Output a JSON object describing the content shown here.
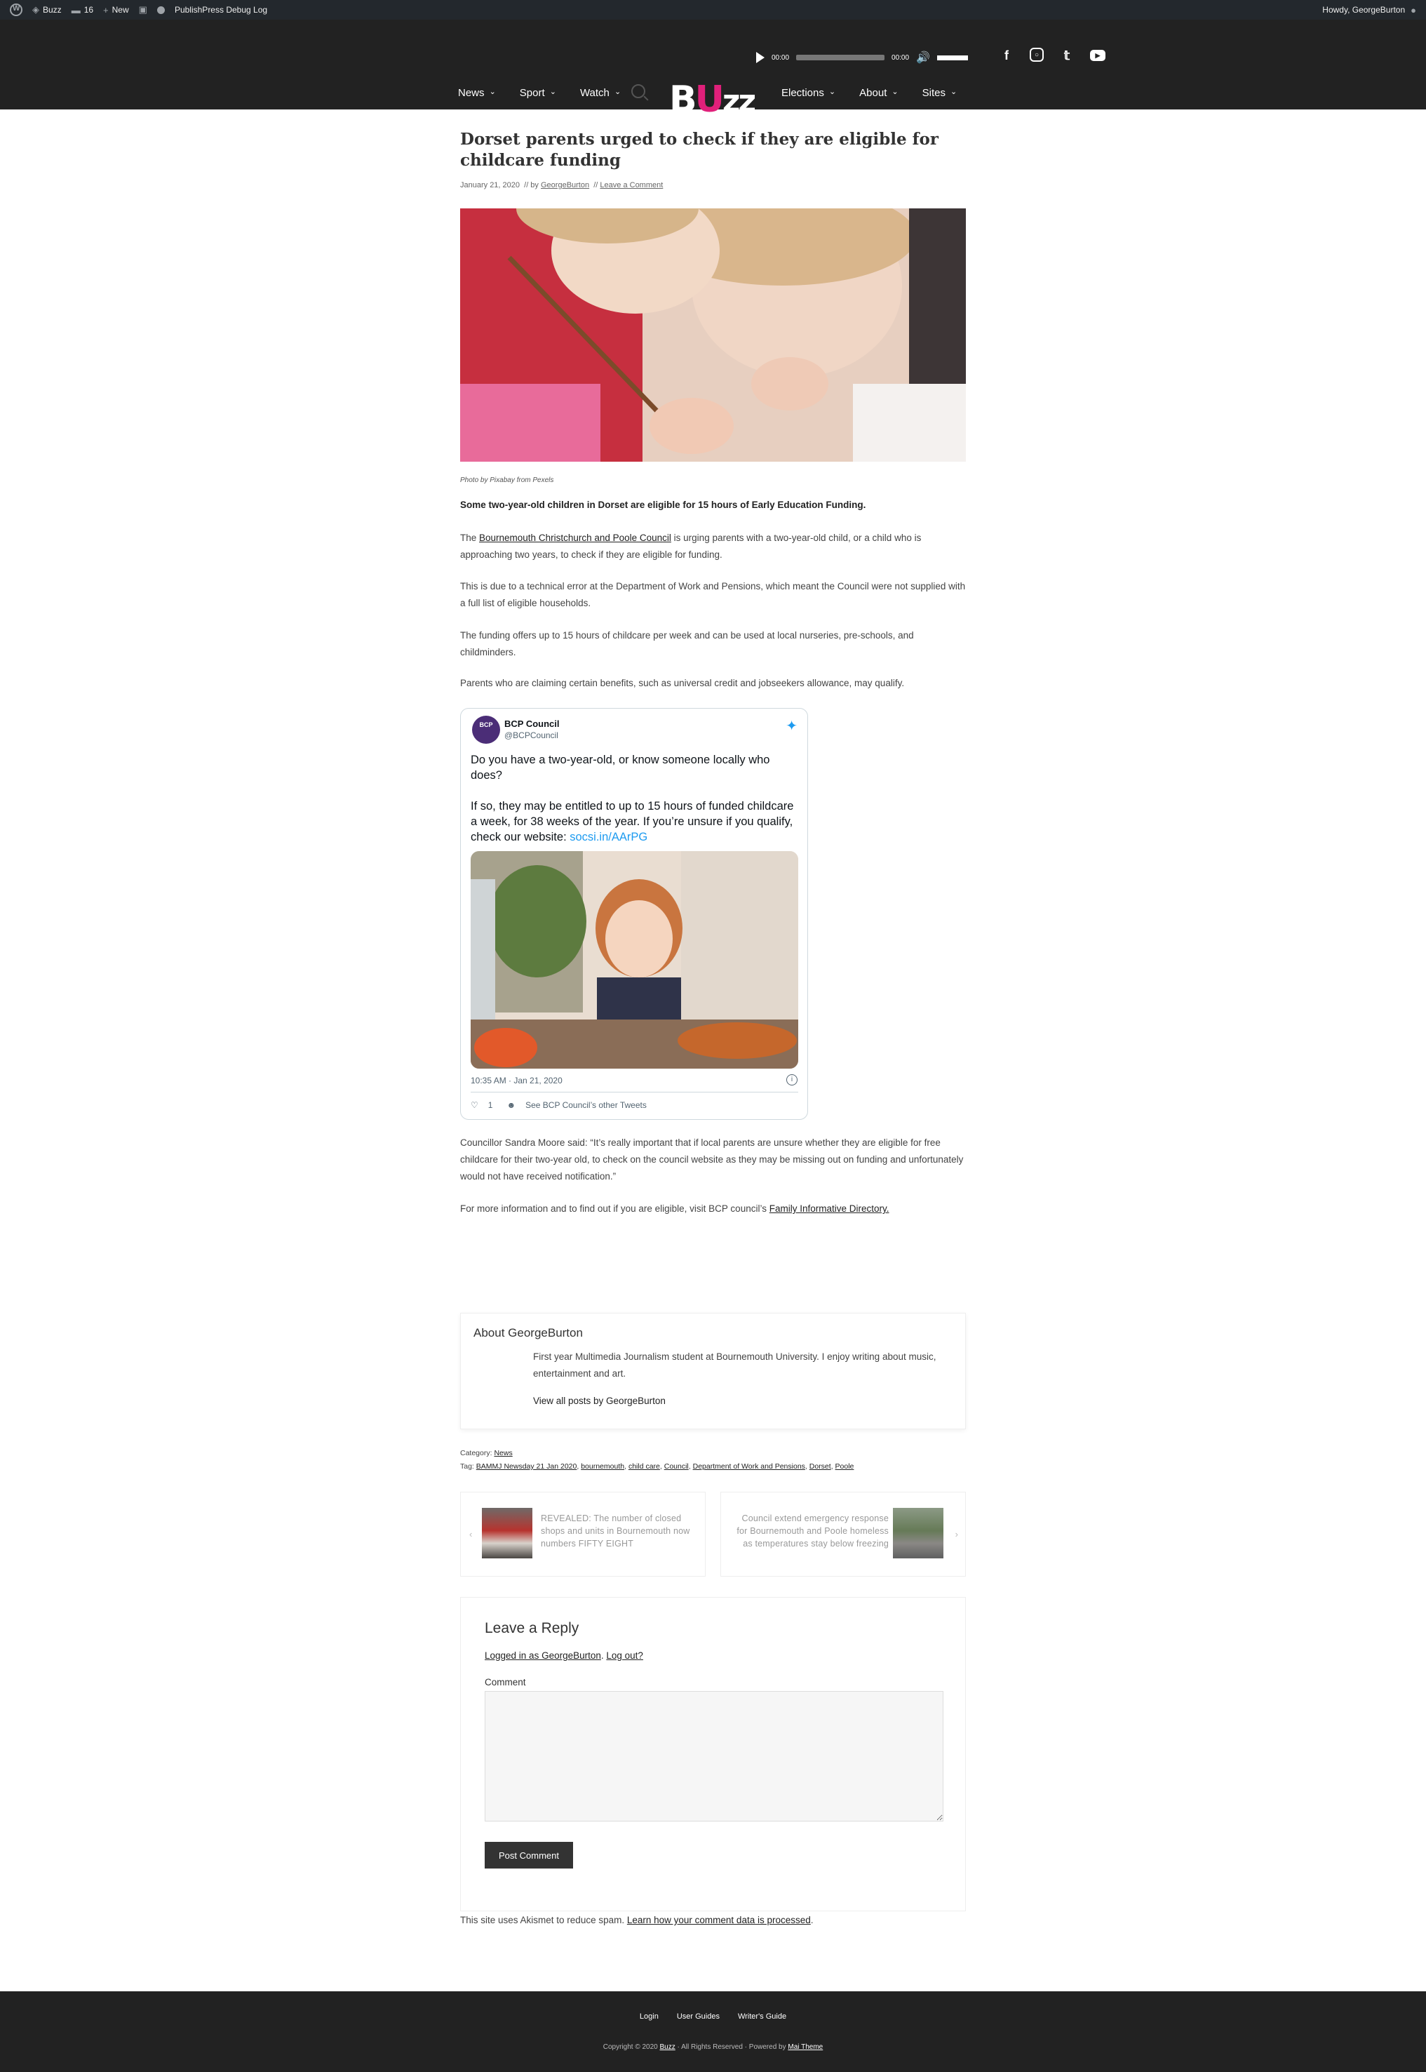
{
  "adminbar": {
    "site_name": "Buzz",
    "comments_count": "16",
    "new_label": "New",
    "debug_log": "PublishPress Debug Log",
    "howdy": "Howdy, GeorgeBurton"
  },
  "player": {
    "current_time": "00:00",
    "duration": "00:00"
  },
  "nav": {
    "left": [
      "News",
      "Sport",
      "Watch"
    ],
    "right": [
      "Elections",
      "About",
      "Sites"
    ]
  },
  "logo": {
    "b": "B",
    "u": "U",
    "zz": "zz"
  },
  "article": {
    "title": "Dorset parents urged to check if they are eligible for childcare funding",
    "date": "January 21, 2020",
    "by": "// by",
    "author": "GeorgeBurton",
    "sep": "//",
    "comment_link": "Leave a Comment",
    "caption": "Photo by Pixabay from Pexels",
    "lead": "Some two-year-old children in Dorset are eligible for 15 hours of Early Education Funding.",
    "p1_pre": "The ",
    "p1_link": "Bournemouth Christchurch and Poole Council",
    "p1_post": " is urging parents with a two-year-old child, or a child who is approaching two years, to check if they are eligible for funding.",
    "p2": "This is due to a technical error at the Department of Work and Pensions, which meant the Council were not supplied with a full list of eligible households.",
    "p3": "The funding offers up to 15 hours of childcare per week and can be used at local nurseries, pre-schools, and childminders.",
    "p4": "Parents who are claiming certain benefits, such as universal credit and jobseekers allowance, may qualify.",
    "p5": "Councillor Sandra Moore said: “It’s really important that if local parents are unsure whether they are eligible for free childcare for their two-year old, to check on the council website as they may be missing out on funding and unfortunately would not have received notification.”",
    "p6_pre": "For more information and to find out if you are eligible, visit BCP council’s ",
    "p6_link": "Family Informative Directory."
  },
  "tweet": {
    "avatar_text": "BCP",
    "name": "BCP Council",
    "handle": "@BCPCouncil",
    "text1": "Do you have a two-year-old, or know someone locally who does?",
    "text2": "If so, they may be entitled to up to 15 hours of funded childcare a week, for 38 weeks of the year. If you’re unsure if you qualify, check our website: ",
    "link": "socsi.in/AArPG",
    "time": "10:35 AM · Jan 21, 2020",
    "likes": "1",
    "other_tweets": "See BCP Council’s other Tweets"
  },
  "author_box": {
    "title": "About GeorgeBurton",
    "bio": "First year Multimedia Journalism student at Bournemouth University. I enjoy writing about music, entertainment and art.",
    "view_all": "View all posts by GeorgeBurton"
  },
  "taxonomy": {
    "category_label": "Category:",
    "category": "News",
    "tag_label": "Tag:",
    "tags": [
      "BAMMJ Newsday 21 Jan 2020",
      "bournemouth",
      "child care",
      "Council",
      "Department of Work and Pensions",
      "Dorset",
      "Poole"
    ]
  },
  "post_nav": {
    "prev": "REVEALED: The number of closed shops and units in Bournemouth now numbers FIFTY EIGHT",
    "next": "Council extend emergency response for Bournemouth and Poole homeless as temperatures stay below freezing"
  },
  "reply": {
    "title": "Leave a Reply",
    "logged_in": "Logged in as GeorgeBurton",
    "logout": "Log out?",
    "comment_label": "Comment",
    "submit": "Post Comment"
  },
  "akismet": {
    "pre": "This site uses Akismet to reduce spam. ",
    "link": "Learn how your comment data is processed",
    "post": "."
  },
  "footer": {
    "links": [
      "Login",
      "User Guides",
      "Writer's Guide"
    ],
    "copy_pre": "Copyright © 2020 ",
    "copy_site": "Buzz",
    "copy_mid": " · All Rights Reserved · Powered by ",
    "copy_theme": "Mai Theme"
  },
  "colors": {
    "brand_pink": "#e0207a",
    "header_bg": "#222222",
    "twitter_blue": "#1d9bf0"
  }
}
